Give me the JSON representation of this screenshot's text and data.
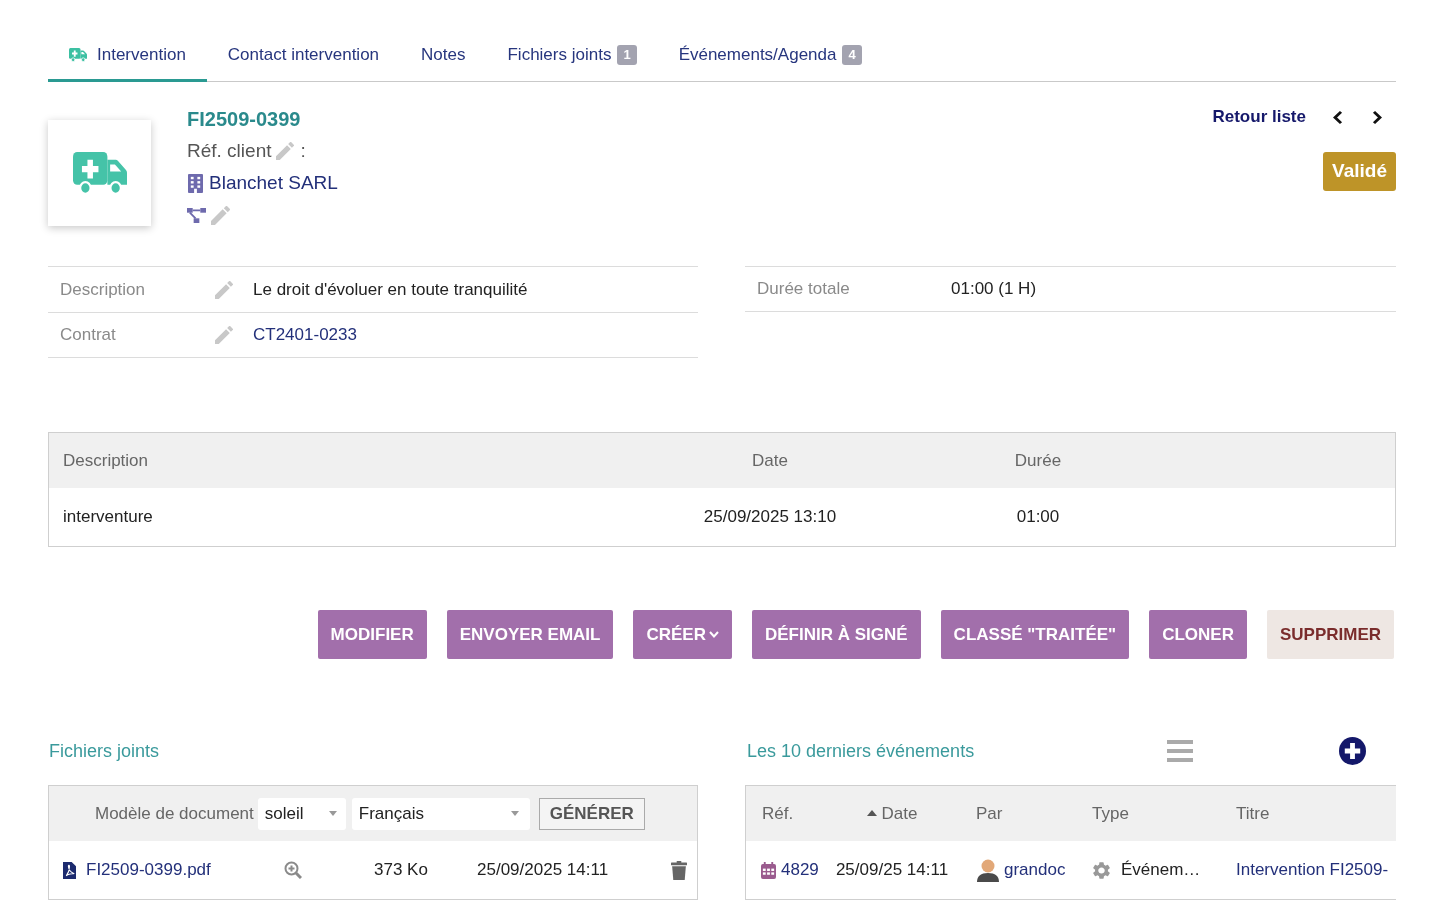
{
  "tabs": [
    {
      "label": "Intervention",
      "selected": true
    },
    {
      "label": "Contact intervention",
      "selected": false
    },
    {
      "label": "Notes",
      "selected": false
    },
    {
      "label": "Fichiers joints",
      "selected": false,
      "badge": "1"
    },
    {
      "label": "Événements/Agenda",
      "selected": false,
      "badge": "4"
    }
  ],
  "header": {
    "ref": "FI2509-0399",
    "client_ref_label": "Réf. client",
    "client_ref_separator": ":",
    "company": "Blanchet SARL"
  },
  "nav": {
    "back": "Retour liste"
  },
  "status": "Validé",
  "fields_left": [
    {
      "label": "Description",
      "value": "Le droit d'évoluer en toute tranquilité",
      "kind": "text",
      "editable": true
    },
    {
      "label": "Contrat",
      "value": "CT2401-0233",
      "kind": "link",
      "editable": true
    }
  ],
  "fields_right": [
    {
      "label": "Durée totale",
      "value": "01:00 (1 H)",
      "kind": "text",
      "editable": false
    }
  ],
  "lines": {
    "columns": [
      "Description",
      "Date",
      "Durée"
    ],
    "rows": [
      [
        "interventure",
        "25/09/2025 13:10",
        "01:00"
      ]
    ]
  },
  "actions": [
    {
      "label": "MODIFIER",
      "kind": "primary"
    },
    {
      "label": "ENVOYER EMAIL",
      "kind": "primary"
    },
    {
      "label": "CRÉER",
      "kind": "dropdown"
    },
    {
      "label": "DÉFINIR À SIGNÉ",
      "kind": "primary"
    },
    {
      "label": "CLASSÉ \"TRAITÉE\"",
      "kind": "primary"
    },
    {
      "label": "CLONER",
      "kind": "primary"
    },
    {
      "label": "SUPPRIMER",
      "kind": "danger"
    }
  ],
  "files": {
    "title": "Fichiers joints",
    "model_label": "Modèle de document",
    "template": "soleil",
    "language": "Français",
    "generate": "GÉNÉRER",
    "rows": [
      {
        "name": "FI2509-0399.pdf",
        "size": "373 Ko",
        "date": "25/09/2025 14:11"
      }
    ]
  },
  "events": {
    "title": "Les 10 derniers événements",
    "columns": [
      {
        "label": "Réf.",
        "sorted": false
      },
      {
        "label": "Date",
        "sorted": true
      },
      {
        "label": "Par",
        "sorted": false
      },
      {
        "label": "Type",
        "sorted": false
      },
      {
        "label": "Titre",
        "sorted": false
      }
    ],
    "rows": [
      {
        "ref": "4829",
        "date": "25/09/25 14:11",
        "by": "grandoc",
        "type": "Événem…",
        "title": "Intervention FI2509-"
      }
    ]
  }
}
